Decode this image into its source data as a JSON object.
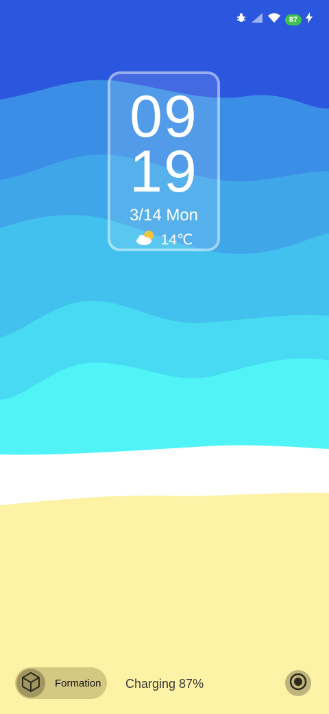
{
  "status_bar": {
    "battery_level": "87",
    "icons": [
      "notification-bug-icon",
      "cellular-signal-icon",
      "wifi-icon",
      "battery-icon",
      "charging-bolt-icon"
    ]
  },
  "clock": {
    "hour": "09",
    "minute": "19",
    "date": "3/14 Mon",
    "temperature": "14℃",
    "weather_icon": "partly-cloudy-icon"
  },
  "bottom": {
    "formation_label": "Formation",
    "charging_text": "Charging 87%",
    "formation_icon": "cube-icon",
    "camera_icon": "camera-shutter-icon"
  },
  "colors": {
    "sky_dark": "#2b56de",
    "wave_1": "#3b8ee6",
    "wave_2": "#3fa6ea",
    "wave_3": "#42c0ee",
    "wave_4": "#48daf2",
    "wave_5": "#50f4f6",
    "foam": "#ffffff",
    "sand": "#fdf2a6",
    "battery_green": "#3fc24f"
  }
}
